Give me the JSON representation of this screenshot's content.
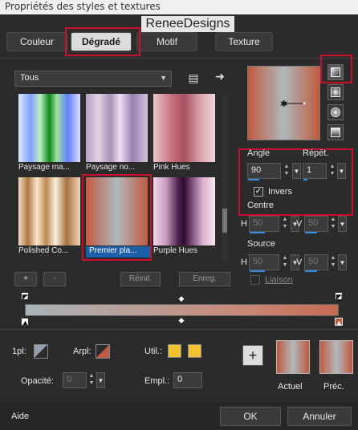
{
  "window": {
    "title": "Propriétés des styles et textures",
    "brand": "ReneeDesigns"
  },
  "tabs": [
    {
      "label": "Couleur"
    },
    {
      "label": "Dégradé"
    },
    {
      "label": "Motif"
    },
    {
      "label": "Texture"
    }
  ],
  "filter": {
    "value": "Tous"
  },
  "gradients": [
    {
      "label": "Paysage ma..."
    },
    {
      "label": "Paysage no..."
    },
    {
      "label": "Pink Hues"
    },
    {
      "label": "Polished Co..."
    },
    {
      "label": "Premier pla..."
    },
    {
      "label": "Purple Hues"
    }
  ],
  "list_buttons": {
    "add": "+",
    "remove": "-",
    "reset": "Réinit.",
    "save": "Enreg."
  },
  "angle": {
    "label": "Angle",
    "value": "90"
  },
  "repeat": {
    "label": "Répét.",
    "value": "1"
  },
  "invert": {
    "label": "Invers",
    "checked": true
  },
  "center": {
    "label": "Centre",
    "h_label": "H",
    "h_value": "50",
    "v_label": "V",
    "v_value": "50"
  },
  "source": {
    "label": "Source",
    "h_label": "H",
    "h_value": "50",
    "v_label": "V",
    "v_value": "50"
  },
  "link": {
    "label": "Liaison"
  },
  "stops": {
    "one_label": "1pl:",
    "arpl_label": "Arpl:",
    "util_label": "Util.:",
    "opacity_label": "Opacité:",
    "opacity_value": "0",
    "empl_label": "Empl.:",
    "empl_value": "0"
  },
  "compare": {
    "add": "+",
    "current_label": "Actuel",
    "previous_label": "Préc."
  },
  "footer": {
    "help": "Aide",
    "ok": "OK",
    "cancel": "Annuler"
  },
  "colors": {
    "accent_blue": "#1b5fa8",
    "highlight_red": "#c8102e",
    "util_yellow": "#f1c232",
    "stop_red": "#c05a40"
  }
}
